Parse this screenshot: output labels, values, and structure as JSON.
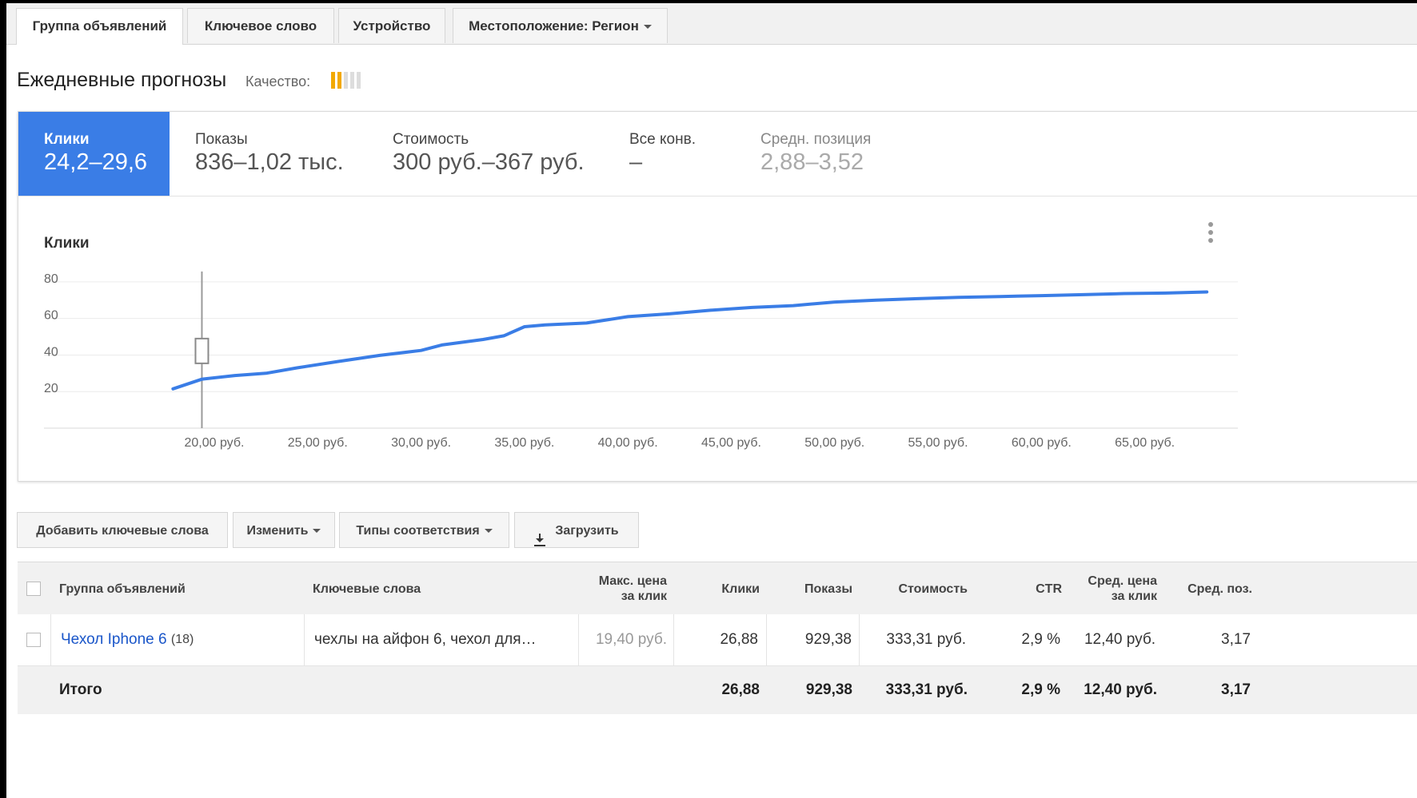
{
  "tabs": [
    {
      "label": "Группа объявлений"
    },
    {
      "label": "Ключевое слово"
    },
    {
      "label": "Устройство"
    },
    {
      "label": "Местоположение: Регион"
    }
  ],
  "heading": {
    "title": "Ежедневные прогнозы",
    "quality_label": "Качество:",
    "quality_level": 2,
    "quality_max": 5
  },
  "metrics": [
    {
      "label": "Клики",
      "value": "24,2–29,6",
      "active": true
    },
    {
      "label": "Показы",
      "value": "836–1,02 тыс."
    },
    {
      "label": "Стоимость",
      "value": "300 руб.–367 руб."
    },
    {
      "label": "Все конв.",
      "value": "–"
    },
    {
      "label": "Средн. позиция",
      "value": "2,88–3,52",
      "muted": true
    }
  ],
  "chart_data": {
    "type": "line",
    "title": "Клики",
    "x_label_suffix": " руб.",
    "x_ticks": [
      20,
      25,
      30,
      35,
      40,
      45,
      50,
      55,
      60,
      65
    ],
    "x_tick_labels": [
      "20,00 руб.",
      "25,00 руб.",
      "30,00 руб.",
      "35,00 руб.",
      "40,00 руб.",
      "45,00 руб.",
      "50,00 руб.",
      "55,00 руб.",
      "60,00 руб.",
      "65,00 руб."
    ],
    "y_ticks": [
      20,
      40,
      60,
      80
    ],
    "xlim": [
      14.2,
      69.5
    ],
    "ylim": [
      0,
      90
    ],
    "grid": true,
    "marker_x": 19.4,
    "series": [
      {
        "color": "#3a7de6",
        "x": [
          18,
          19.4,
          21,
          22.5,
          24,
          26,
          28,
          30,
          31,
          33,
          34,
          35,
          36,
          38,
          40,
          42,
          44,
          46,
          48,
          50,
          52,
          54,
          56,
          58,
          60,
          62,
          64,
          66,
          68
        ],
        "y": [
          21.5,
          26.8,
          28.8,
          30,
          33,
          36.5,
          39.8,
          42.5,
          45.5,
          48.5,
          50.5,
          55.5,
          56.5,
          57.5,
          61,
          62.5,
          64.5,
          66,
          67,
          69,
          70,
          70.8,
          71.5,
          72,
          72.5,
          73,
          73.6,
          73.9,
          74.5
        ]
      }
    ]
  },
  "toolbar": {
    "add_keywords": "Добавить ключевые слова",
    "edit": "Изменить",
    "match_types": "Типы соответствия",
    "download": "Загрузить"
  },
  "table": {
    "headers": {
      "ad_group": "Группа объявлений",
      "keywords": "Ключевые слова",
      "max_cpc_line1": "Макс. цена",
      "max_cpc_line2": "за клик",
      "clicks": "Клики",
      "impressions": "Показы",
      "cost": "Стоимость",
      "ctr": "CTR",
      "avg_cpc_line1": "Сред. цена",
      "avg_cpc_line2": "за клик",
      "avg_pos": "Сред. поз."
    },
    "row": {
      "ad_group": "Чехол Iphone 6",
      "ad_group_count": "(18)",
      "keywords": "чехлы на айфон 6, чехол для…",
      "max_cpc": "19,40 руб.",
      "clicks": "26,88",
      "impressions": "929,38",
      "cost": "333,31 руб.",
      "ctr": "2,9 %",
      "avg_cpc": "12,40 руб.",
      "avg_pos": "3,17"
    },
    "total": {
      "label": "Итого",
      "clicks": "26,88",
      "impressions": "929,38",
      "cost": "333,31 руб.",
      "ctr": "2,9 %",
      "avg_cpc": "12,40 руб.",
      "avg_pos": "3,17"
    }
  },
  "colors": {
    "accent": "#3a7de6",
    "link": "#1a56c9",
    "quality_on": "#f2a900",
    "quality_off": "#dddddd"
  }
}
